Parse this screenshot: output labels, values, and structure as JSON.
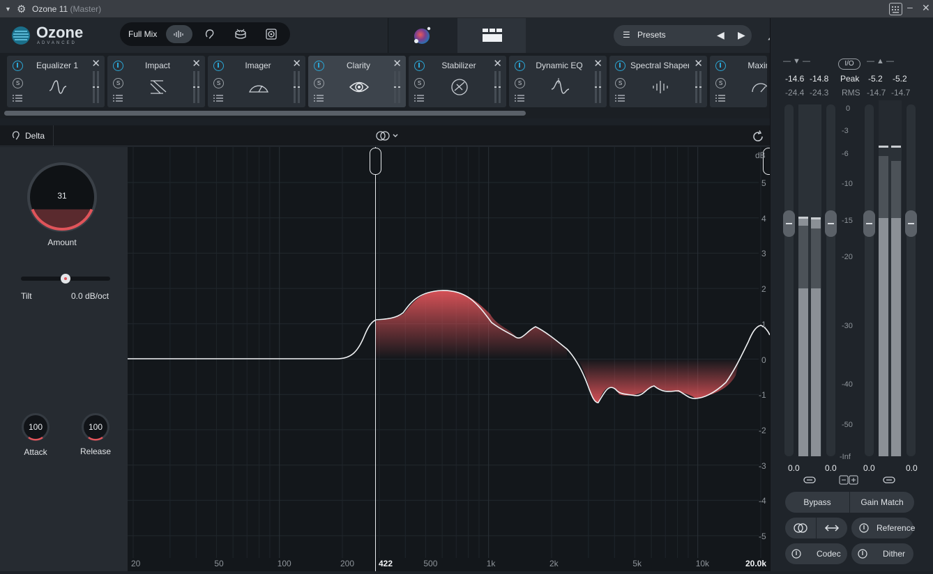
{
  "window": {
    "app_title": "Ozone 11",
    "context": "(Master)"
  },
  "header": {
    "logo_text": "Ozone",
    "logo_sub": "ADVANCED",
    "view_label": "Full Mix",
    "view_icons": [
      "waveform-icon",
      "listen-icon",
      "drum-icon",
      "speaker-icon"
    ],
    "presets_label": "Presets"
  },
  "modules": [
    {
      "name": "Equalizer 1",
      "icon": "eq-curve-icon",
      "selected": false
    },
    {
      "name": "Impact",
      "icon": "impact-icon",
      "selected": false
    },
    {
      "name": "Imager",
      "icon": "imager-icon",
      "selected": false
    },
    {
      "name": "Clarity",
      "icon": "eye-icon",
      "selected": true
    },
    {
      "name": "Stabilizer",
      "icon": "stabilizer-icon",
      "selected": false
    },
    {
      "name": "Dynamic EQ",
      "icon": "dynamic-eq-icon",
      "selected": false
    },
    {
      "name": "Spectral Shaper",
      "icon": "spectral-icon",
      "selected": false
    },
    {
      "name": "Maxim",
      "icon": "maximizer-icon",
      "selected": false
    }
  ],
  "module_s_label": "S",
  "editor": {
    "delta_label": "Delta"
  },
  "controls": {
    "amount_value": "31",
    "amount_label": "Amount",
    "amount_fraction": 0.31,
    "tilt_label": "Tilt",
    "tilt_value": "0.0 dB/oct",
    "attack_value": "100",
    "attack_label": "Attack",
    "release_value": "100",
    "release_label": "Release"
  },
  "graph": {
    "db_unit": "dB",
    "db_ticks": [
      "5",
      "4",
      "3",
      "2",
      "1",
      "0",
      "-1",
      "-2",
      "-3",
      "-4",
      "-5"
    ],
    "freq_ticks": [
      "20",
      "50",
      "100",
      "200",
      "500",
      "1k",
      "2k",
      "5k",
      "10k"
    ],
    "low_cutoff_label": "422",
    "high_cutoff_label": "20.0k"
  },
  "meters": {
    "in_peak": [
      "-14.6",
      "-14.8"
    ],
    "in_rms": [
      "-24.4",
      "-24.3"
    ],
    "out_peak": [
      "-5.2",
      "-5.2"
    ],
    "out_rms": [
      "-14.7",
      "-14.7"
    ],
    "peak_label": "Peak",
    "rms_label": "RMS",
    "io_label": "I/O",
    "scale": [
      "0",
      "-3",
      "-6",
      "-10",
      "-15",
      "-20",
      "-30",
      "-40",
      "-50",
      "-Inf"
    ],
    "in_gain": [
      "0.0",
      "0.0"
    ],
    "out_gain": [
      "0.0",
      "0.0"
    ]
  },
  "buttons": {
    "bypass": "Bypass",
    "gain_match": "Gain Match",
    "reference": "Reference",
    "codec": "Codec",
    "dither": "Dither"
  },
  "colors": {
    "accent_blue": "#2aa8d8",
    "curve_red": "#e0545a",
    "bg_dark": "#13171b"
  }
}
